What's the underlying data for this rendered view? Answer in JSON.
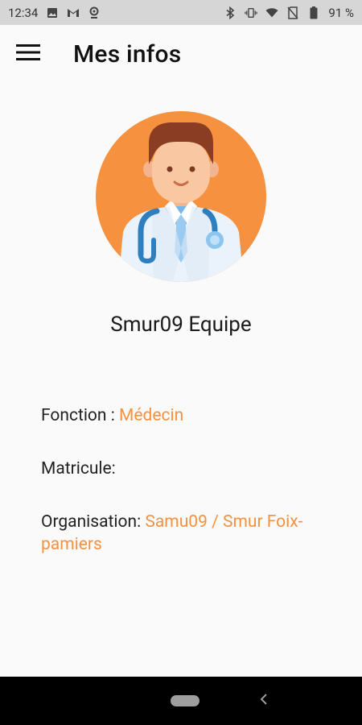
{
  "status_bar": {
    "time": "12:34",
    "battery": "91 %",
    "left_icons": [
      "image-icon",
      "gmail-icon",
      "location-icon"
    ],
    "right_icons": [
      "bluetooth-icon",
      "vibrate-icon",
      "wifi-icon",
      "no-sim-icon",
      "battery-icon"
    ]
  },
  "app_bar": {
    "title": "Mes infos",
    "menu_icon": "hamburger-menu-icon"
  },
  "profile": {
    "avatar_icon": "doctor-avatar-icon",
    "name": "Smur09 Equipe",
    "fonction_label": "Fonction : ",
    "fonction_value": "Médecin",
    "matricule_label": "Matricule:",
    "matricule_value": "",
    "organisation_label": "Organisation: ",
    "organisation_value": "Samu09 / Smur Foix-pamiers"
  },
  "colors": {
    "accent": "#f5913f",
    "status_bar_bg": "#d6d6d6",
    "background": "#fafafa",
    "nav_bar_bg": "#000000"
  },
  "nav_bar": {
    "icons": [
      "home-pill-icon",
      "back-chevron-icon"
    ]
  }
}
